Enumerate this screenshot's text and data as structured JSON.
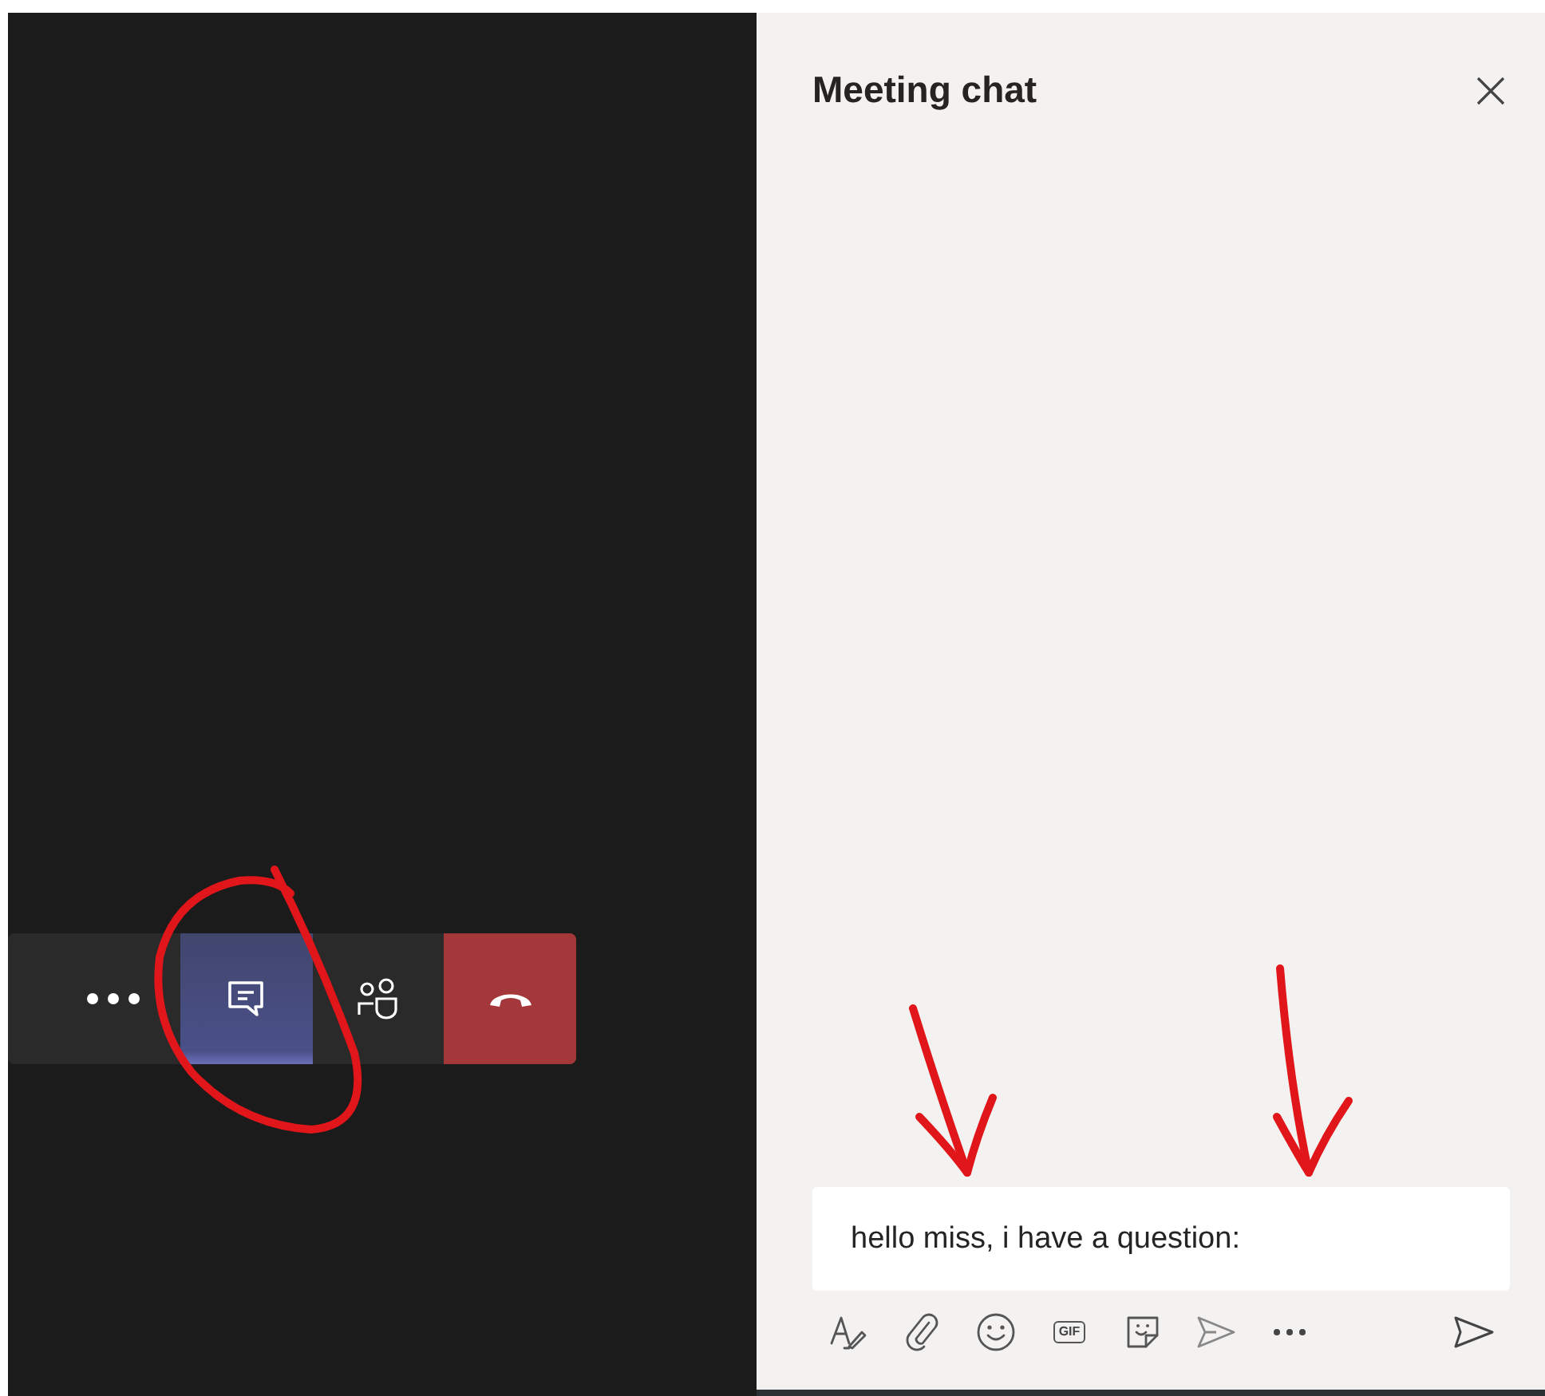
{
  "call_controls": [
    {
      "kind": "more",
      "selected": false
    },
    {
      "kind": "chat",
      "selected": true
    },
    {
      "kind": "participants",
      "selected": false
    },
    {
      "kind": "hangup",
      "selected": false
    }
  ],
  "chat": {
    "title": "Meeting chat",
    "message_value": "hello miss, i have a question:",
    "tools": [
      {
        "kind": "format"
      },
      {
        "kind": "attach"
      },
      {
        "kind": "emoji"
      },
      {
        "kind": "gif",
        "label": "GIF"
      },
      {
        "kind": "sticker"
      },
      {
        "kind": "praise"
      },
      {
        "kind": "more"
      }
    ]
  },
  "annotations": [
    {
      "kind": "circle"
    },
    {
      "kind": "arrow"
    },
    {
      "kind": "arrow"
    }
  ]
}
